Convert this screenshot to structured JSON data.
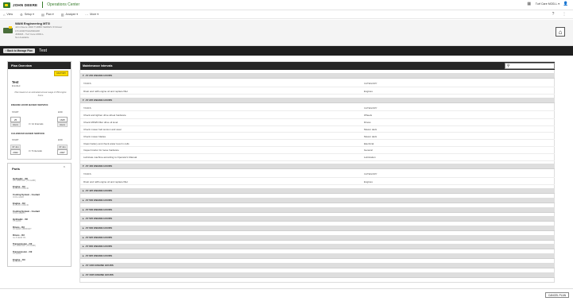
{
  "header": {
    "brand": "JOHN DEERE",
    "app_title": "Operations Center",
    "org": "Turf Care MOD-L ▾",
    "nav": [
      {
        "label": "View"
      },
      {
        "label": "Setup ▾"
      },
      {
        "label": "Plan ▾"
      },
      {
        "label": "Analyze ▾"
      },
      {
        "label": "More ▾"
      }
    ]
  },
  "machine": {
    "name": "WAM Engineering MTG",
    "line1": "John Deere 1600 TURBO SERIES III Mower",
    "line2": "1TC1600TVHM030228",
    "line3": "JD6826 - Turf Care MOD-L",
    "line4": "Not Available"
  },
  "plan_bar": {
    "back_label": "Back to Manage Plan",
    "title": "Test"
  },
  "plan_overview": {
    "header": "Plan Overview",
    "badge": "FACTORY",
    "title": "Test",
    "subtitle": "Enrolled",
    "note": "Plan based on an estimated annual usage of 250 engine hours",
    "engine_section": "ENGINE HOUR BASED SERVICE",
    "start_label": "START",
    "end_label": "END",
    "engine_start": "25",
    "engine_end": "1625",
    "engine_unit": "Hours",
    "engine_interval": "3 / 12 Intervals",
    "calendar_section": "CALENDAR BASED SERVICE",
    "cal_start": "2022",
    "cal_end": "2027",
    "cal_start_top": "07 Jun",
    "cal_end_top": "07 Jun",
    "cal_interval": "3 / 5 Intervals"
  },
  "parts": {
    "header": "Parts",
    "items": [
      {
        "name": "Hydraulic - Oil",
        "desc": "JD LUBRICANT (HY-GARD)"
      },
      {
        "name": "Engine - Oil",
        "desc": "PLUS-50 II 10W-30"
      },
      {
        "name": "Cooling System - Coolant",
        "desc": "COOL-GARD"
      },
      {
        "name": "Engine - Oil",
        "desc": "PLUS-50 II 10W-30"
      },
      {
        "name": "Cooling System - Coolant",
        "desc": "COOL-GARD II"
      },
      {
        "name": "Hydraulic - Oil",
        "desc": "HY-GARD"
      },
      {
        "name": "Drives - Oil",
        "desc": "JD GEAR LUBRICANT"
      },
      {
        "name": "Drives - Oil",
        "desc": "GL-5 GEAR OIL"
      },
      {
        "name": "Transmission - Oil",
        "desc": "JD LUBRICANT (HY-GARD)"
      },
      {
        "name": "Transmission - Oil",
        "desc": "HY-GARD"
      },
      {
        "name": "Engine - Oil",
        "desc": "PLUS-50 II"
      }
    ]
  },
  "main": {
    "header": "Maintenance Intervals",
    "search_placeholder": "",
    "col_task": "TASKS",
    "col_category": "CATEGORY",
    "groups": [
      {
        "label": "AT 200 ENGINE HOURS",
        "open": true,
        "rows": [
          {
            "task": "Drain and refill engine oil and replace filter",
            "cat": "Engines"
          }
        ]
      },
      {
        "label": "AT 225 ENGINE HOURS",
        "open": true,
        "rows": [
          {
            "task": "Check and tighten drive wheel hardware",
            "cat": "Wheels"
          },
          {
            "task": "Check MFWD filler drive oil level",
            "cat": "Drives"
          },
          {
            "task": "Check mower belt tension and wear",
            "cat": "Mower deck"
          },
          {
            "task": "Check mower blades",
            "cat": "Mower deck"
          },
          {
            "task": "Clean battery and check water level in cells",
            "cat": "Electrical"
          },
          {
            "task": "Inspect tractor for loose hardware",
            "cat": "General"
          },
          {
            "task": "Lubricate machine according to Operator's Manual",
            "cat": "Lubrication"
          }
        ]
      },
      {
        "label": "AT 400 ENGINE HOURS",
        "open": true,
        "rows": [
          {
            "task": "Drain and refill engine oil and replace filter",
            "cat": "Engines"
          }
        ]
      },
      {
        "label": "AT 425 ENGINE HOURS",
        "open": false,
        "rows": []
      },
      {
        "label": "AT 500 ENGINE HOURS",
        "open": false,
        "rows": []
      },
      {
        "label": "AT 500 ENGINE HOURS",
        "open": false,
        "rows": []
      },
      {
        "label": "AT 525 ENGINE HOURS",
        "open": false,
        "rows": []
      },
      {
        "label": "AT 600 ENGINE HOURS",
        "open": false,
        "rows": []
      },
      {
        "label": "AT 625 ENGINE HOURS",
        "open": false,
        "rows": []
      },
      {
        "label": "AT 800 ENGINE HOURS",
        "open": false,
        "rows": []
      },
      {
        "label": "AT 825 ENGINE HOURS",
        "open": false,
        "rows": []
      },
      {
        "label": "AT 1000 ENGINE HOURS",
        "open": false,
        "rows": []
      },
      {
        "label": "AT 1625 ENGINE HOURS",
        "open": false,
        "rows": []
      }
    ]
  },
  "footer": {
    "cancel": "CANCEL PLAN"
  }
}
